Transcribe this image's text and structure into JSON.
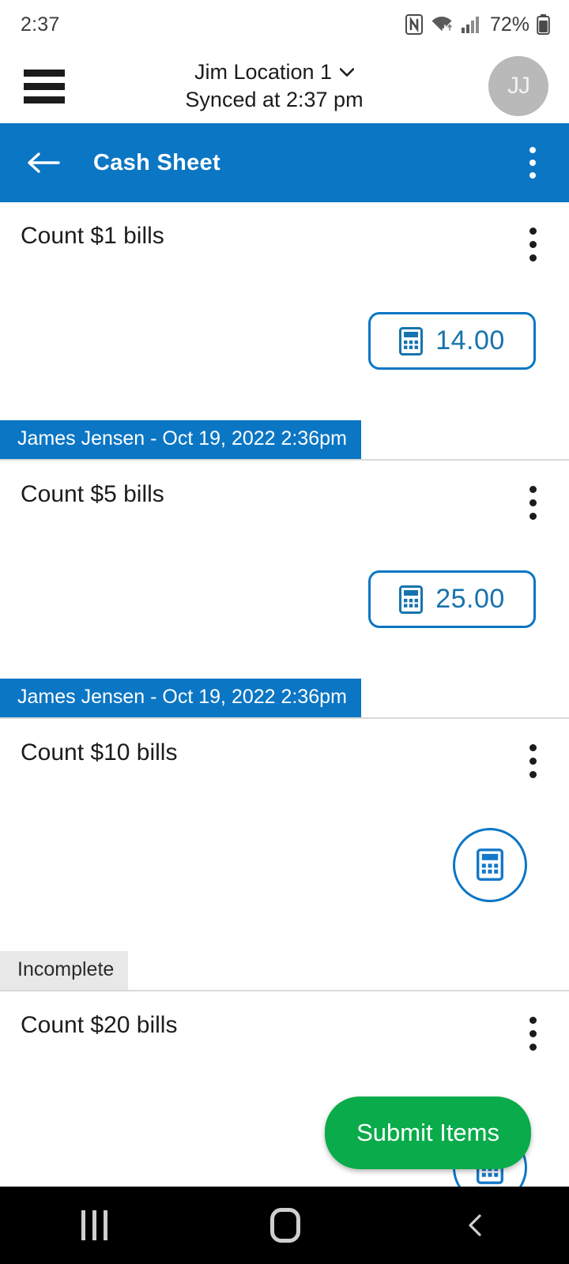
{
  "status_bar": {
    "time": "2:37",
    "battery_percent": "72%",
    "icons": [
      "nfc-icon",
      "wifi-icon",
      "cellular-signal-icon",
      "battery-icon"
    ]
  },
  "header": {
    "menu_icon": "hamburger-menu-icon",
    "location": "Jim Location 1",
    "dropdown_icon": "chevron-down-icon",
    "sync_status": "Synced at 2:37 pm",
    "avatar_initials": "JJ"
  },
  "toolbar": {
    "back_icon": "arrow-left-icon",
    "title": "Cash Sheet",
    "overflow_icon": "more-vertical-icon",
    "color": "#0b76c4"
  },
  "items": [
    {
      "title": "Count $1 bills",
      "value": "14.00",
      "has_value": true,
      "calculator_icon": "calculator-icon",
      "footer_label": "James Jensen - Oct 19, 2022 2:36pm",
      "footer_type": "user"
    },
    {
      "title": "Count $5 bills",
      "value": "25.00",
      "has_value": true,
      "calculator_icon": "calculator-icon",
      "footer_label": "James Jensen - Oct 19, 2022 2:36pm",
      "footer_type": "user"
    },
    {
      "title": "Count $10 bills",
      "value": "",
      "has_value": false,
      "calculator_icon": "calculator-icon",
      "footer_label": "Incomplete",
      "footer_type": "status"
    },
    {
      "title": "Count $20 bills",
      "value": "",
      "has_value": false,
      "calculator_icon": "calculator-icon",
      "footer_label": "",
      "footer_type": "none"
    }
  ],
  "fab": {
    "label": "Submit Items",
    "color": "#0aab4a"
  },
  "nav_bar": {
    "recents_icon": "recents-icon",
    "home_icon": "home-icon",
    "back_icon": "back-chevron-icon"
  },
  "colors": {
    "accent_blue": "#0b76c4",
    "value_blue": "#1773ad",
    "submit_green": "#0aab4a",
    "badge_gray": "#e8e8e8"
  }
}
